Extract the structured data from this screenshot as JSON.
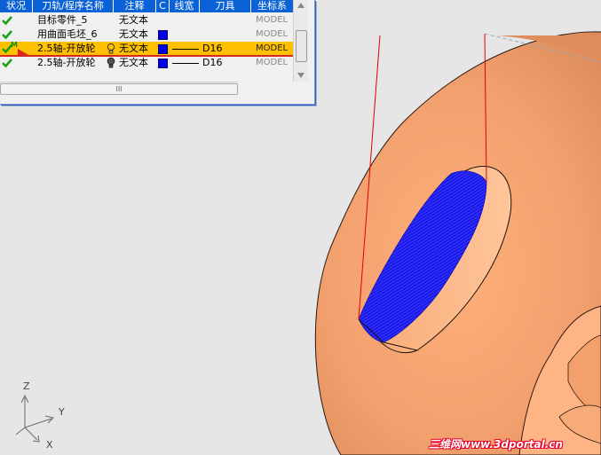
{
  "navigator": {
    "columns": [
      "状况",
      "刀轨/程序名称",
      "注释",
      "C",
      "线宽",
      "刀具",
      "坐标系"
    ],
    "rows": [
      {
        "name": "目标零件_5",
        "note": "无文本",
        "has_color": false,
        "line": false,
        "tool": "",
        "coord": "MODEL",
        "flag": "",
        "selected": false
      },
      {
        "name": "用曲面毛坯_6",
        "note": "无文本",
        "has_color": true,
        "line": false,
        "tool": "",
        "coord": "MODEL",
        "flag": "",
        "selected": false
      },
      {
        "name": "2.5轴-开放轮",
        "note": "无文本",
        "has_color": true,
        "line": true,
        "tool": "D16",
        "coord": "MODEL",
        "flag": "M",
        "selected": true
      },
      {
        "name": "2.5轴-开放轮",
        "note": "无文本",
        "has_color": true,
        "line": true,
        "tool": "D16",
        "coord": "MODEL",
        "flag": "",
        "selected": false
      }
    ],
    "hscroll_grip": "III",
    "colors": {
      "header": "#0b62d6",
      "selected_row": "#ffc000",
      "selected_border": "#d8281f",
      "toolpath_color": "#0000e6"
    }
  },
  "triad": {
    "z_label": "Z",
    "y_label": "Y",
    "x_label": "X"
  },
  "viewport": {
    "background": "#e6e6e6",
    "part_color": "#f2a06e",
    "toolpath_color": "#1515e8",
    "tool_axis_color": "#e00000"
  },
  "watermark": "三维网www.3dportal.cn"
}
